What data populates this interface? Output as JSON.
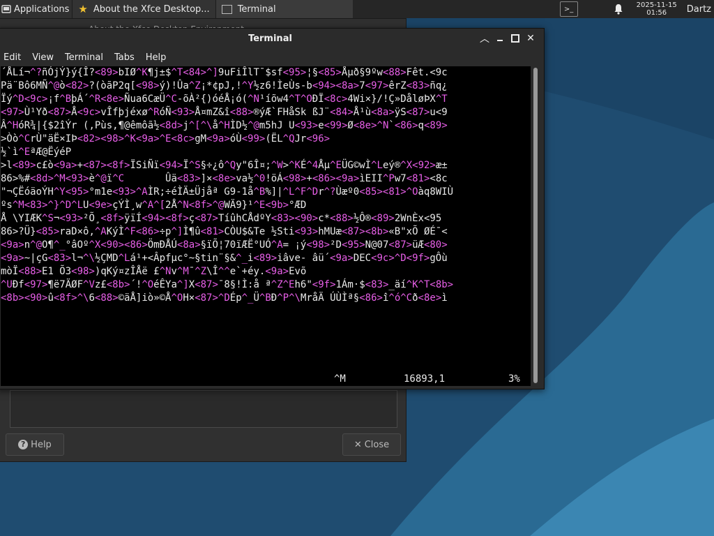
{
  "panel": {
    "applications_label": "Applications",
    "tasks": [
      {
        "label": "About the Xfce Desktop..."
      },
      {
        "label": "Terminal"
      }
    ],
    "clock_date": "2025-11-15",
    "clock_time": "01:56",
    "user": "Dartz"
  },
  "about_dialog": {
    "title": "About the Xfce Desktop Environment",
    "help_label": "Help",
    "close_label": "Close"
  },
  "terminal": {
    "title": "Terminal",
    "menu": [
      "Edit",
      "View",
      "Terminal",
      "Tabs",
      "Help"
    ],
    "lines": [
      "´ÅLí¬^?ñÓjÝ}ý{Î?<89>bIØ^K¶j±$^T<84>^]9uFiÎlT¯$sf<95>¦§<85>Åµð§9ºw<88>Fêt.<9c",
      "Pä¨Bô6MÑ^@ò<82>?(òãP2q[<98>ý)!Ûa^Z¡*¢pJ,!^Y½z6!ÌeÙs-b<94><8a>7<97>êrZ<83>ñq¿",
      "Ïý^D<9c>¡f^BþÁ´^R<8e>Ñua6CæÜ^C-õÀ²{)óéÅ¡ó(^N¹íõw4^T^OÐÏ<8c>4Wi×}/!Ç»DåløÞX^T",
      "<97>Ù¹Yð<87>Å<9c>vÎfþjéxø^RóÑ<93>Å¤mZ&î<88>®ýÆ`FHåSk ßJ¨<84>Å¹ù<8a>ÿS<87>u<9",
      "Â^HóR¾|{$2îÝr (,Pùs,¶@êmôã½<8d>j^[^\\å^HÌD½^@m5hJ U<93>e<99>Ø<8e>^N`<86>q<89>",
      ">Òò^CrÙ\"äË×IÞ<82><98>^K<9a>^E<8c>gM<9a>óÙ<99>(ËL^QJr<96>",
      "½`ì^EªÆ@ËýéP",
      ">l<89>c£ò<9a>+<87><8f>ÏSiÑï<94>Ï^S§÷¿ô^Qy\"6Î¤;^W>^KÉ^4Åµ^EÜG©wÌ^Leý®^X<92>æ±",
      "86>%#<8d>^M<93>è^@ï^C       Ûä<83>]×<8e>va½^0!öÁ<98>+<86><9a>ìEII^Pw7<81><8c",
      "\"¬ÇËóäoÝH^Y<95>°m1e<93>^AÌR;÷éÌÄ±Üjåª G9-1å^B%]|^L^F^Dr^?Ùæº0<85><81>^Oàq8WIÙ",
      "ºs^M<83>^}^D^LU<9e>çÝÌ¸w^A^[2Å^N<8f>^@WÄ9}¹^E<9b>°ÆD",
      "Å \\YIÆK^S¬<93>²Õ¸<8f>ÿïÍ<94><8f>ç<87>TíûhCÅdºY<83><90>c*<88>½Ô®<89>2WnÈx<95",
      "86>?Ü}<85>raD×ô,^AKýÌ^F<86>÷p^]Ì¶û<81>CÒU$&Te ½Sti<93>hMUæ<87><8b>«B\"xÕ ØÉ¯<",
      "<9a>n^@O¶^_°âOº^X<90><86>ÖmÐÅÚ<8a>§ïÕ¦70ïÆË°UÓ^A= ¡ý<98>²D<95>N@07<87>üÆ<80>",
      "<9a>~|çG<83>l¬^\\½ÇMD^Lá¹+<Âpfµc°~§tin¨§&^_i<89>iâve- âü´<9a>DEC<9c>^D<9f>gÔù",
      "mòÏ<88>E1 Õ3<98>)qKý¤zÎÅë £^Nv^M¯^Z\\Î^^e`+éy.<9a>Evõ",
      "^UÐf<97>¶ë7ÄØF^Vz£<8b>´!^OéÊYa^]X<87>¯8§!Ì:å ª^Z^Eh6\"<9f>1Ám·$<83>_äí^K^T<8b>",
      "<8b><90>û<8f>^\\6<88>©äÅ]iò»©Å^OH×<87>^DÉp^_Ü^BÐ^P^\\MråÄ ÚÙÌª§<86>î^ó^Cð<8e>ì"
    ],
    "status_cursor": "^M",
    "status_position": "16893,1",
    "status_percent": "3%"
  }
}
